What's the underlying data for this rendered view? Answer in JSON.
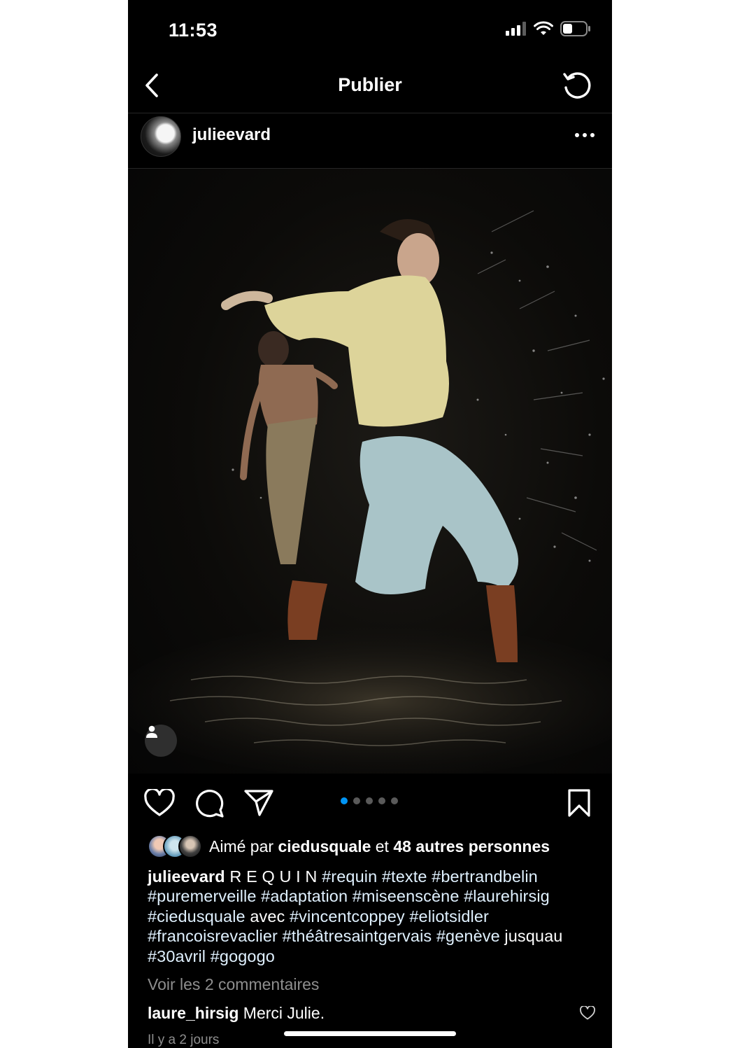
{
  "status_bar": {
    "time": "11:53",
    "icons": [
      "signal-icon",
      "wifi-icon",
      "battery-icon"
    ]
  },
  "nav": {
    "title": "Publier",
    "back_icon": "chevron-left-icon",
    "refresh_icon": "refresh-icon"
  },
  "post": {
    "username": "julieevard",
    "more_icon": "more-horizontal-icon",
    "tag_icon": "user-tag-icon",
    "carousel": {
      "count": 5,
      "active_index": 0
    }
  },
  "actions": {
    "like_icon": "heart-icon",
    "comment_icon": "comment-icon",
    "share_icon": "paper-plane-icon",
    "save_icon": "bookmark-icon"
  },
  "likes": {
    "prefix": "Aimé par",
    "user": "ciedusquale",
    "middle": "et",
    "others": "48 autres personnes"
  },
  "caption": {
    "username": "julieevard",
    "parts": [
      {
        "text": " R E Q U I N ",
        "tag": false
      },
      {
        "text": "#requin",
        "tag": true
      },
      {
        "text": " ",
        "tag": false
      },
      {
        "text": "#texte",
        "tag": true
      },
      {
        "text": " ",
        "tag": false
      },
      {
        "text": "#bertrandbelin",
        "tag": true
      },
      {
        "text": " ",
        "tag": false
      },
      {
        "text": "#puremerveille",
        "tag": true
      },
      {
        "text": " ",
        "tag": false
      },
      {
        "text": "#adaptation",
        "tag": true
      },
      {
        "text": " ",
        "tag": false
      },
      {
        "text": "#miseenscène",
        "tag": true
      },
      {
        "text": " ",
        "tag": false
      },
      {
        "text": "#laurehirsig",
        "tag": true
      },
      {
        "text": " ",
        "tag": false
      },
      {
        "text": "#ciedusquale",
        "tag": true
      },
      {
        "text": " avec ",
        "tag": false
      },
      {
        "text": "#vincentcoppey",
        "tag": true
      },
      {
        "text": " ",
        "tag": false
      },
      {
        "text": "#eliotsidler",
        "tag": true
      },
      {
        "text": " ",
        "tag": false
      },
      {
        "text": "#francoisrevaclier",
        "tag": true
      },
      {
        "text": " ",
        "tag": false
      },
      {
        "text": "#théâtresaintgervais",
        "tag": true
      },
      {
        "text": " ",
        "tag": false
      },
      {
        "text": "#genève",
        "tag": true
      },
      {
        "text": " jusquau ",
        "tag": false
      },
      {
        "text": "#30avril",
        "tag": true
      },
      {
        "text": " ",
        "tag": false
      },
      {
        "text": "#gogogo",
        "tag": true
      }
    ]
  },
  "comments": {
    "view_all": "Voir les 2 commentaires",
    "items": [
      {
        "username": "laure_hirsig",
        "text": "Merci Julie."
      }
    ]
  },
  "time_ago": "Il y a 2 jours",
  "colors": {
    "background": "#000000",
    "hashtag": "#e0f1ff",
    "muted": "#8e8e8e",
    "carousel_active": "#0095f6"
  }
}
